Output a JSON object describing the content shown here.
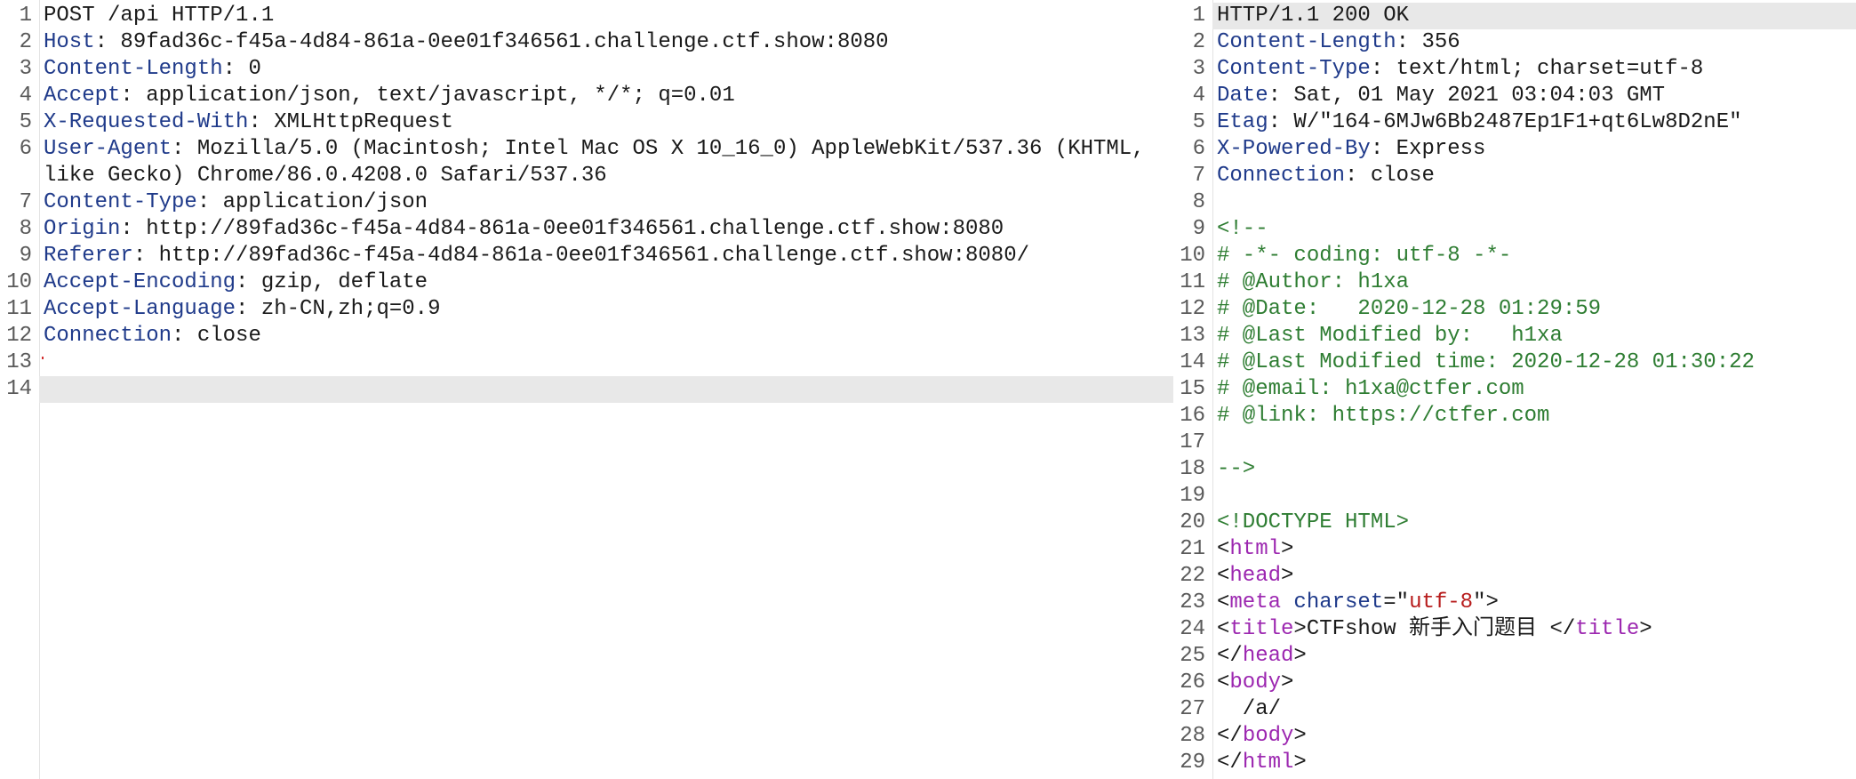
{
  "request": {
    "lines": [
      {
        "n": "1",
        "parts": [
          {
            "t": "POST /api HTTP/1.1",
            "c": "plain"
          }
        ]
      },
      {
        "n": "2",
        "parts": [
          {
            "t": "Host",
            "c": "key"
          },
          {
            "t": ": 89fad36c-f45a-4d84-861a-0ee01f346561.challenge.ctf.show:8080",
            "c": "val"
          }
        ]
      },
      {
        "n": "3",
        "parts": [
          {
            "t": "Content-Length",
            "c": "key"
          },
          {
            "t": ": 0",
            "c": "val"
          }
        ]
      },
      {
        "n": "4",
        "parts": [
          {
            "t": "Accept",
            "c": "key"
          },
          {
            "t": ": application/json, text/javascript, */*; q=0.01",
            "c": "val"
          }
        ]
      },
      {
        "n": "5",
        "parts": [
          {
            "t": "X-Requested-With",
            "c": "key"
          },
          {
            "t": ": XMLHttpRequest",
            "c": "val"
          }
        ]
      },
      {
        "n": "6",
        "wrapped": true,
        "parts": [
          {
            "t": "User-Agent",
            "c": "key"
          },
          {
            "t": ": Mozilla/5.0 (Macintosh; Intel Mac OS X 10_16_0) AppleWebKit/537.36 (KHTML, like Gecko) Chrome/86.0.4208.0 Safari/537.36",
            "c": "val"
          }
        ]
      },
      {
        "n": "7",
        "parts": [
          {
            "t": "Content-Type",
            "c": "key"
          },
          {
            "t": ": application/json",
            "c": "val"
          }
        ]
      },
      {
        "n": "8",
        "parts": [
          {
            "t": "Origin",
            "c": "key"
          },
          {
            "t": ": http://89fad36c-f45a-4d84-861a-0ee01f346561.challenge.ctf.show:8080",
            "c": "val"
          }
        ]
      },
      {
        "n": "9",
        "parts": [
          {
            "t": "Referer",
            "c": "key"
          },
          {
            "t": ": http://89fad36c-f45a-4d84-861a-0ee01f346561.challenge.ctf.show:8080/",
            "c": "val"
          }
        ]
      },
      {
        "n": "10",
        "parts": [
          {
            "t": "Accept-Encoding",
            "c": "key"
          },
          {
            "t": ": gzip, deflate",
            "c": "val"
          }
        ]
      },
      {
        "n": "11",
        "parts": [
          {
            "t": "Accept-Language",
            "c": "key"
          },
          {
            "t": ": zh-CN,zh;q=0.9",
            "c": "val"
          }
        ]
      },
      {
        "n": "12",
        "parts": [
          {
            "t": "Connection",
            "c": "key"
          },
          {
            "t": ": close",
            "c": "val"
          }
        ]
      },
      {
        "n": "13",
        "cursor": true,
        "parts": []
      },
      {
        "n": "14",
        "highlight": true,
        "parts": []
      }
    ]
  },
  "response": {
    "lines": [
      {
        "n": "1",
        "highlight": true,
        "parts": [
          {
            "t": "HTTP/1.1 200 OK",
            "c": "plain"
          }
        ]
      },
      {
        "n": "2",
        "parts": [
          {
            "t": "Content-Length",
            "c": "key"
          },
          {
            "t": ": 356",
            "c": "val"
          }
        ]
      },
      {
        "n": "3",
        "parts": [
          {
            "t": "Content-Type",
            "c": "key"
          },
          {
            "t": ": text/html; charset=utf-8",
            "c": "val"
          }
        ]
      },
      {
        "n": "4",
        "parts": [
          {
            "t": "Date",
            "c": "key"
          },
          {
            "t": ": Sat, 01 May 2021 03:04:03 GMT",
            "c": "val"
          }
        ]
      },
      {
        "n": "5",
        "parts": [
          {
            "t": "Etag",
            "c": "key"
          },
          {
            "t": ": W/\"164-6MJw6Bb2487Ep1F1+qt6Lw8D2nE\"",
            "c": "val"
          }
        ]
      },
      {
        "n": "6",
        "parts": [
          {
            "t": "X-Powered-By",
            "c": "key"
          },
          {
            "t": ": Express",
            "c": "val"
          }
        ]
      },
      {
        "n": "7",
        "parts": [
          {
            "t": "Connection",
            "c": "key"
          },
          {
            "t": ": close",
            "c": "val"
          }
        ]
      },
      {
        "n": "8",
        "parts": []
      },
      {
        "n": "9",
        "parts": [
          {
            "t": "<!--",
            "c": "comment"
          }
        ]
      },
      {
        "n": "10",
        "parts": [
          {
            "t": "# -*- coding: utf-8 -*-",
            "c": "comment"
          }
        ]
      },
      {
        "n": "11",
        "parts": [
          {
            "t": "# @Author: h1xa",
            "c": "comment"
          }
        ]
      },
      {
        "n": "12",
        "parts": [
          {
            "t": "# @Date:   2020-12-28 01:29:59",
            "c": "comment"
          }
        ]
      },
      {
        "n": "13",
        "parts": [
          {
            "t": "# @Last Modified by:   h1xa",
            "c": "comment"
          }
        ]
      },
      {
        "n": "14",
        "parts": [
          {
            "t": "# @Last Modified time: 2020-12-28 01:30:22",
            "c": "comment"
          }
        ]
      },
      {
        "n": "15",
        "parts": [
          {
            "t": "# @email: h1xa@ctfer.com",
            "c": "comment"
          }
        ]
      },
      {
        "n": "16",
        "parts": [
          {
            "t": "# @link: https://ctfer.com",
            "c": "comment"
          }
        ]
      },
      {
        "n": "17",
        "parts": []
      },
      {
        "n": "18",
        "parts": [
          {
            "t": "-->",
            "c": "comment"
          }
        ]
      },
      {
        "n": "19",
        "parts": []
      },
      {
        "n": "20",
        "parts": [
          {
            "t": "<!DOCTYPE HTML>",
            "c": "comment"
          }
        ]
      },
      {
        "n": "21",
        "parts": [
          {
            "t": "<",
            "c": "plain"
          },
          {
            "t": "html",
            "c": "tag"
          },
          {
            "t": ">",
            "c": "plain"
          }
        ]
      },
      {
        "n": "22",
        "parts": [
          {
            "t": "<",
            "c": "plain"
          },
          {
            "t": "head",
            "c": "tag"
          },
          {
            "t": ">",
            "c": "plain"
          }
        ]
      },
      {
        "n": "23",
        "parts": [
          {
            "t": "<",
            "c": "plain"
          },
          {
            "t": "meta",
            "c": "tag"
          },
          {
            "t": " ",
            "c": "plain"
          },
          {
            "t": "charset",
            "c": "attr"
          },
          {
            "t": "=\"",
            "c": "plain"
          },
          {
            "t": "utf-8",
            "c": "str"
          },
          {
            "t": "\">",
            "c": "plain"
          }
        ]
      },
      {
        "n": "24",
        "parts": [
          {
            "t": "<",
            "c": "plain"
          },
          {
            "t": "title",
            "c": "tag"
          },
          {
            "t": ">CTFshow 新手入门题目 </",
            "c": "plain"
          },
          {
            "t": "title",
            "c": "tag"
          },
          {
            "t": ">",
            "c": "plain"
          }
        ]
      },
      {
        "n": "25",
        "parts": [
          {
            "t": "</",
            "c": "plain"
          },
          {
            "t": "head",
            "c": "tag"
          },
          {
            "t": ">",
            "c": "plain"
          }
        ]
      },
      {
        "n": "26",
        "parts": [
          {
            "t": "<",
            "c": "plain"
          },
          {
            "t": "body",
            "c": "tag"
          },
          {
            "t": ">",
            "c": "plain"
          }
        ]
      },
      {
        "n": "27",
        "parts": [
          {
            "t": "  /a/",
            "c": "plain"
          }
        ]
      },
      {
        "n": "28",
        "parts": [
          {
            "t": "</",
            "c": "plain"
          },
          {
            "t": "body",
            "c": "tag"
          },
          {
            "t": ">",
            "c": "plain"
          }
        ]
      },
      {
        "n": "29",
        "parts": [
          {
            "t": "</",
            "c": "plain"
          },
          {
            "t": "html",
            "c": "tag"
          },
          {
            "t": ">",
            "c": "plain"
          }
        ]
      }
    ]
  },
  "splitter": {
    "glyph": "⋮"
  }
}
